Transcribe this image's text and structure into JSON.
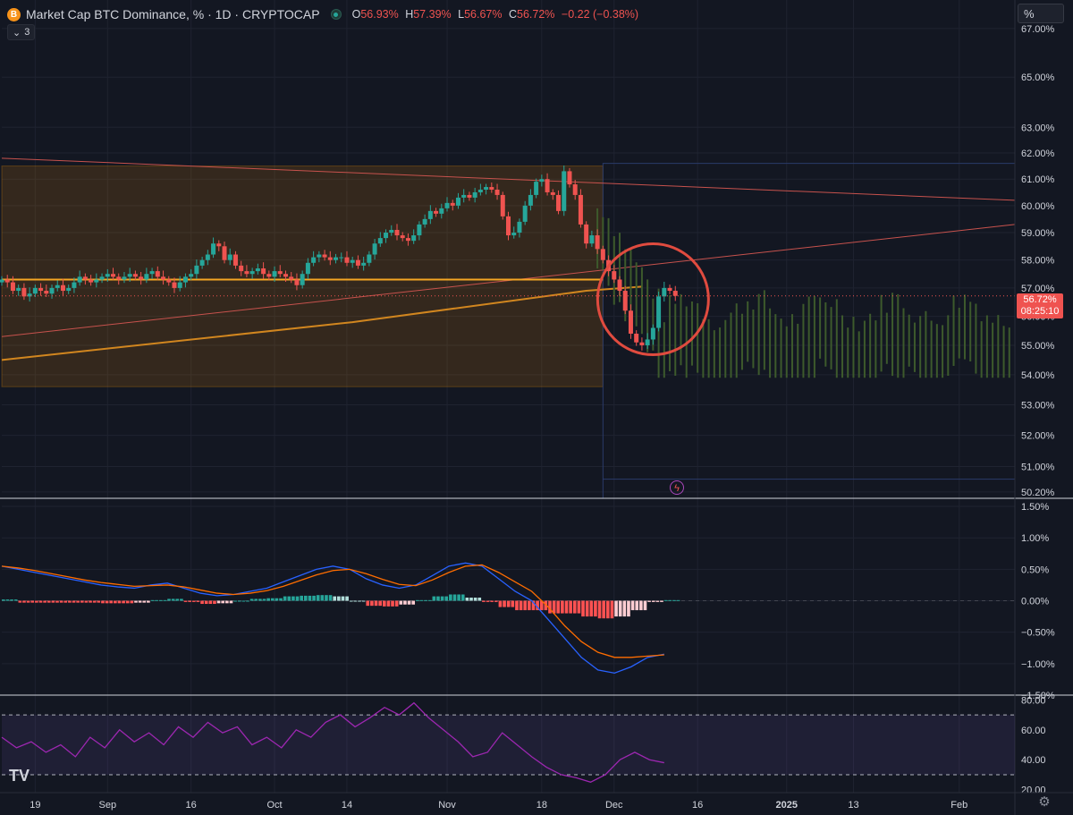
{
  "header": {
    "title": "Market Cap BTC Dominance, % · 1D · CRYPTOCAP",
    "open_label": "O",
    "open": "56.93%",
    "high_label": "H",
    "high": "57.39%",
    "low_label": "L",
    "low": "56.67%",
    "close_label": "C",
    "close": "56.72%",
    "change": "−0.22 (−0.38%)",
    "indicator_count": "3",
    "logo_letter": "B",
    "scale_mode": "%"
  },
  "current_price": {
    "value": "56.72%",
    "countdown": "08:25:10",
    "color": "#ef5350"
  },
  "colors": {
    "up": "#26a69a",
    "down": "#ef5350",
    "background": "#131722",
    "grid": "#1f2330",
    "macd": "#2962ff",
    "signal": "#ff6d00",
    "rsi": "#9c27b0",
    "projection": "#3d5a2c"
  },
  "icons": {
    "logo": "tradingview-logo-icon",
    "settings": "gear-icon",
    "event": "lightning-bolt-icon"
  },
  "chart_data": [
    {
      "type": "candlestick",
      "pane": "price",
      "ylim": [
        50.0,
        68.2
      ],
      "yscale": "log",
      "y_ticks": [
        "67.00%",
        "65.00%",
        "63.00%",
        "62.00%",
        "61.00%",
        "60.00%",
        "59.00%",
        "58.00%",
        "57.00%",
        "56.00%",
        "55.00%",
        "54.00%",
        "53.00%",
        "52.00%",
        "51.00%",
        "50.20%"
      ],
      "y_tick_values": [
        67,
        65,
        63,
        62,
        61,
        60,
        59,
        58,
        57,
        56,
        55,
        54,
        53,
        52,
        51,
        50.2
      ],
      "x_ticks": [
        {
          "label": "19",
          "x": "2024-08-19"
        },
        {
          "label": "Sep",
          "x": "2024-09-01"
        },
        {
          "label": "16",
          "x": "2024-09-16"
        },
        {
          "label": "Oct",
          "x": "2024-10-01"
        },
        {
          "label": "14",
          "x": "2024-10-14"
        },
        {
          "label": "Nov",
          "x": "2024-11-01"
        },
        {
          "label": "18",
          "x": "2024-11-18"
        },
        {
          "label": "Dec",
          "x": "2024-12-01"
        },
        {
          "label": "16",
          "x": "2024-12-16"
        },
        {
          "label": "2025",
          "x": "2025-01-01"
        },
        {
          "label": "13",
          "x": "2025-01-13"
        },
        {
          "label": "Feb",
          "x": "2025-02-01"
        }
      ],
      "date_range": [
        "2024-08-13",
        "2025-02-11"
      ],
      "candles_start": "2024-08-13",
      "close": [
        57.3,
        57.2,
        56.9,
        57.0,
        56.7,
        56.8,
        57.0,
        56.9,
        56.8,
        57.0,
        57.1,
        56.9,
        57.0,
        57.2,
        57.4,
        57.3,
        57.2,
        57.3,
        57.4,
        57.5,
        57.4,
        57.3,
        57.4,
        57.5,
        57.4,
        57.3,
        57.5,
        57.6,
        57.4,
        57.3,
        57.2,
        57.0,
        57.2,
        57.4,
        57.5,
        57.8,
        58.0,
        58.2,
        58.6,
        58.5,
        58.0,
        58.2,
        57.8,
        57.6,
        57.5,
        57.6,
        57.7,
        57.5,
        57.4,
        57.6,
        57.5,
        57.4,
        57.3,
        57.1,
        57.5,
        57.9,
        58.1,
        58.2,
        58.1,
        58.0,
        58.1,
        58.1,
        57.9,
        58.0,
        57.8,
        57.9,
        58.2,
        58.6,
        58.8,
        59.0,
        59.1,
        58.9,
        58.8,
        58.7,
        58.9,
        59.3,
        59.5,
        59.8,
        59.7,
        59.9,
        60.1,
        60.0,
        60.3,
        60.4,
        60.3,
        60.5,
        60.6,
        60.7,
        60.6,
        60.4,
        59.6,
        58.9,
        59.0,
        59.4,
        60.0,
        60.4,
        60.9,
        61.0,
        60.5,
        60.4,
        59.8,
        61.3,
        60.8,
        60.4,
        59.3,
        58.6,
        58.9,
        58.4,
        58.0,
        57.6,
        57.3,
        56.9,
        56.2,
        55.4,
        55.1,
        55.0,
        55.2,
        55.6,
        56.7,
        57.0,
        56.9,
        56.72
      ],
      "projection_range": {
        "start": "2024-11-28",
        "end": "2025-02-11",
        "min": 53.9,
        "max": 59.9
      },
      "annotations": {
        "range_box": {
          "x_start": "2024-08-13",
          "x_end": "2024-11-29",
          "y_top": 61.5,
          "y_bottom": 53.6
        },
        "date_range_box": {
          "x_start": "2024-11-29",
          "y_top": 61.6,
          "y_bottom": 50.6
        },
        "horizontal_line": 57.3,
        "circle_center": {
          "x": "2024-12-08",
          "y": 56.6
        },
        "trendline_down": [
          {
            "x": "2024-08-13",
            "y": 61.8
          },
          {
            "x": "2025-02-11",
            "y": 60.2
          }
        ],
        "trendline_up": [
          {
            "x": "2024-08-13",
            "y": 55.3
          },
          {
            "x": "2025-02-11",
            "y": 59.3
          }
        ],
        "moving_average": [
          {
            "x": "2024-08-13",
            "y": 54.5
          },
          {
            "x": "2024-10-15",
            "y": 55.8
          },
          {
            "x": "2024-11-26",
            "y": 56.9
          },
          {
            "x": "2024-12-06",
            "y": 57.05
          }
        ]
      }
    },
    {
      "type": "histogram",
      "pane": "macd",
      "ylim": [
        -1.5,
        1.6
      ],
      "y_ticks": [
        "1.50%",
        "1.00%",
        "0.50%",
        "0.00%",
        "−0.50%",
        "−1.00%",
        "−1.50%"
      ],
      "y_tick_values": [
        1.5,
        1.0,
        0.5,
        0.0,
        -0.5,
        -1.0,
        -1.5
      ],
      "macd": [
        0.55,
        0.5,
        0.45,
        0.4,
        0.35,
        0.3,
        0.25,
        0.22,
        0.2,
        0.25,
        0.28,
        0.2,
        0.12,
        0.08,
        0.1,
        0.15,
        0.2,
        0.3,
        0.4,
        0.5,
        0.55,
        0.5,
        0.35,
        0.25,
        0.2,
        0.25,
        0.4,
        0.55,
        0.6,
        0.55,
        0.35,
        0.15,
        0.0,
        -0.3,
        -0.6,
        -0.9,
        -1.1,
        -1.15,
        -1.05,
        -0.9,
        -0.85
      ],
      "signal": [
        0.55,
        0.52,
        0.48,
        0.43,
        0.38,
        0.33,
        0.29,
        0.26,
        0.23,
        0.24,
        0.25,
        0.22,
        0.17,
        0.12,
        0.1,
        0.12,
        0.16,
        0.23,
        0.32,
        0.41,
        0.48,
        0.5,
        0.43,
        0.34,
        0.26,
        0.24,
        0.33,
        0.45,
        0.55,
        0.57,
        0.45,
        0.3,
        0.15,
        -0.1,
        -0.4,
        -0.65,
        -0.82,
        -0.9,
        -0.9,
        -0.88,
        -0.86
      ],
      "histogram": [
        0.02,
        -0.03,
        -0.03,
        -0.03,
        -0.03,
        -0.03,
        -0.04,
        -0.04,
        -0.03,
        0.01,
        0.03,
        -0.02,
        -0.05,
        -0.04,
        0.0,
        0.03,
        0.04,
        0.07,
        0.08,
        0.09,
        0.07,
        0.0,
        -0.08,
        -0.09,
        -0.06,
        0.01,
        0.07,
        0.1,
        0.05,
        -0.02,
        -0.1,
        -0.15,
        -0.15,
        -0.2,
        -0.2,
        -0.25,
        -0.28,
        -0.25,
        -0.15,
        -0.02,
        0.01
      ]
    },
    {
      "type": "line",
      "pane": "rsi",
      "ylim": [
        18,
        82
      ],
      "y_ticks": [
        "80.00",
        "60.00",
        "40.00",
        "20.00"
      ],
      "y_tick_values": [
        80,
        60,
        40,
        20
      ],
      "bands": [
        70,
        30
      ],
      "rsi": [
        55,
        48,
        52,
        45,
        50,
        42,
        55,
        48,
        60,
        52,
        58,
        50,
        62,
        55,
        65,
        58,
        62,
        50,
        55,
        48,
        60,
        55,
        65,
        70,
        62,
        68,
        75,
        70,
        78,
        68,
        60,
        52,
        42,
        45,
        58,
        50,
        42,
        35,
        30,
        28,
        25,
        30,
        40,
        45,
        40,
        38
      ]
    }
  ]
}
